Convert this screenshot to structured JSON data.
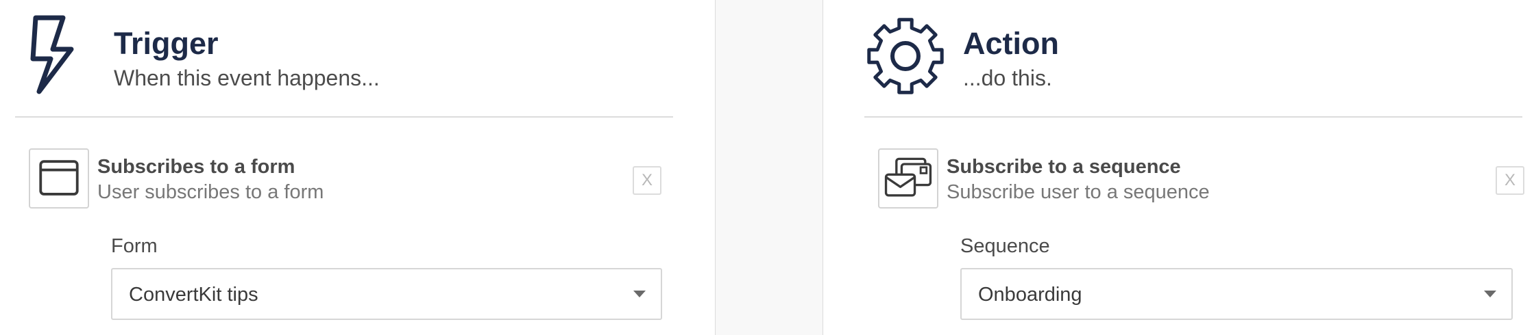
{
  "trigger": {
    "icon": "lightning-bolt-icon",
    "title": "Trigger",
    "subtitle": "When this event happens...",
    "step": {
      "icon": "browser-window-icon",
      "title": "Subscribes to a form",
      "description": "User subscribes to a form",
      "remove_label": "X"
    },
    "field": {
      "label": "Form",
      "value": "ConvertKit tips"
    }
  },
  "action": {
    "icon": "gear-icon",
    "title": "Action",
    "subtitle": "...do this.",
    "step": {
      "icon": "stacked-envelopes-icon",
      "title": "Subscribe to a sequence",
      "description": "Subscribe user to a sequence",
      "remove_label": "X"
    },
    "field": {
      "label": "Sequence",
      "value": "Onboarding"
    }
  },
  "colors": {
    "heading": "#1d2a48",
    "border": "#dcdcdc",
    "gutter": "#f8f8f8"
  }
}
